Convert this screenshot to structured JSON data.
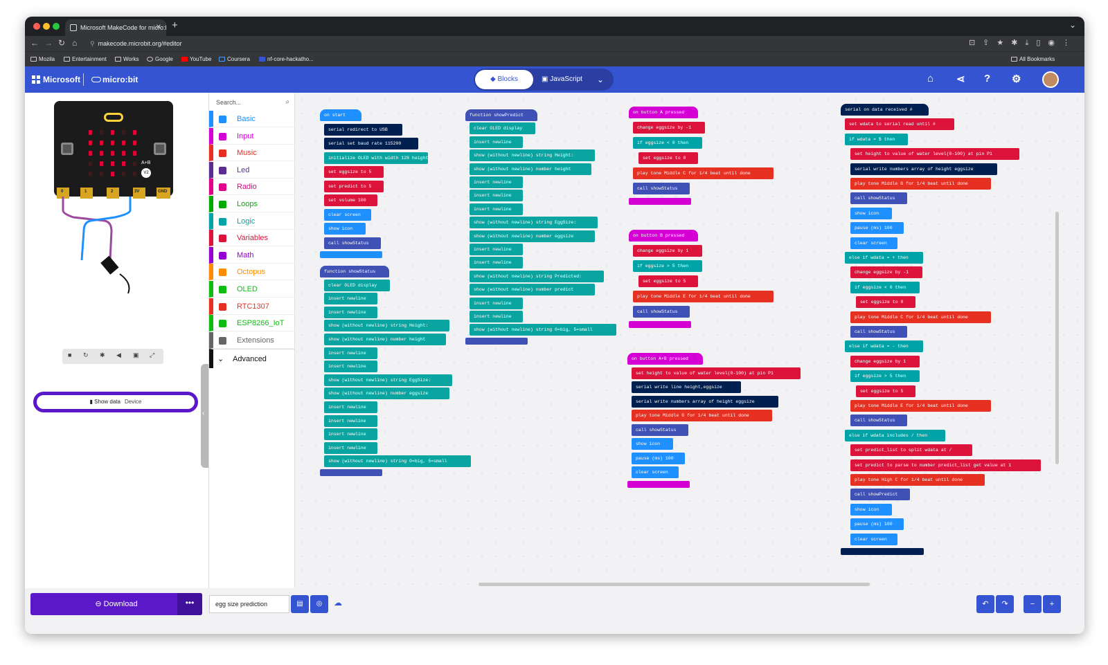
{
  "browser": {
    "tab_title": "Microsoft MakeCode for micro:bit",
    "url": "makecode.microbit.org/#editor",
    "bookmarks": [
      "Mozila",
      "Entertainment",
      "Works",
      "Google",
      "YouTube",
      "Coursera",
      "nf-core-hackatho...",
      "All Bookmarks"
    ]
  },
  "header": {
    "brand": "Microsoft",
    "product": "micro:bit",
    "tab_blocks": "Blocks",
    "tab_js": "JavaScript"
  },
  "simulator": {
    "button_label": "A+B",
    "version": "V2",
    "pins": [
      "0",
      "1",
      "2",
      "3V",
      "GND"
    ],
    "show_data": "Show data",
    "show_data_device": "Device"
  },
  "toolbox": {
    "search_placeholder": "Search...",
    "categories": [
      {
        "label": "Basic",
        "color": "#1e90ff"
      },
      {
        "label": "Input",
        "color": "#d400d4"
      },
      {
        "label": "Music",
        "color": "#e63022"
      },
      {
        "label": "Led",
        "color": "#5c2d91"
      },
      {
        "label": "Radio",
        "color": "#e3008c"
      },
      {
        "label": "Loops",
        "color": "#00aa00"
      },
      {
        "label": "Logic",
        "color": "#00a4a6"
      },
      {
        "label": "Variables",
        "color": "#dc143c"
      },
      {
        "label": "Math",
        "color": "#9400d3"
      },
      {
        "label": "Octopus",
        "color": "#ff8c00"
      },
      {
        "label": "OLED",
        "color": "#0fbc11"
      },
      {
        "label": "RTC1307",
        "color": "#e63022"
      },
      {
        "label": "ESP8266_IoT",
        "color": "#0fbc11"
      },
      {
        "label": "Extensions",
        "color": "#666666"
      }
    ],
    "advanced": "Advanced"
  },
  "blocks": {
    "on_start": [
      "on start",
      "serial redirect to USB",
      "serial set baud rate 115200",
      "initialize OLED with width 128 height 64",
      "set eggsize to 5",
      "set predict to 5",
      "set volume 100",
      "clear screen",
      "show icon",
      "call showStatus"
    ],
    "show_status": [
      "function showStatus",
      "clear OLED display",
      "insert newline",
      "insert newline",
      "show (without newline) string Height:",
      "show (without newline) number height",
      "insert newline",
      "insert newline",
      "show (without newline) string EggSize:",
      "show (without newline) number eggsize",
      "insert newline",
      "insert newline",
      "insert newline",
      "insert newline",
      "show (without newline) string 0=big, 5=small"
    ],
    "show_predict": [
      "function showPredict",
      "clear OLED display",
      "insert newline",
      "show (without newline) string Height:",
      "show (without newline) number height",
      "insert newline",
      "insert newline",
      "insert newline",
      "show (without newline) string EggSize:",
      "show (without newline) number eggsize",
      "insert newline",
      "insert newline",
      "show (without newline) string Predicted:",
      "show (without newline) number predict",
      "insert newline",
      "insert newline",
      "show (without newline) string 0=big, 5=small"
    ],
    "button_a": [
      "on button A pressed",
      "change eggsize by -1",
      "if eggsize < 0 then",
      "set eggsize to 0",
      "play tone Middle C for 1/4 beat until done",
      "call showStatus"
    ],
    "button_b": [
      "on button B pressed",
      "change eggsize by 1",
      "if eggsize > 5 then",
      "set eggsize to 5",
      "play tone Middle E for 1/4 beat until done",
      "call showStatus"
    ],
    "button_ab": [
      "on button A+B pressed",
      "set height to value of water level(0-100) at pin P1",
      "serial write line height,eggsize",
      "serial write numbers array of height eggsize",
      "play tone Middle G for 1/4 beat until done",
      "call showStatus",
      "show icon",
      "pause (ms) 100",
      "clear screen"
    ],
    "serial": [
      "serial on data received #",
      "set wdata to serial read until #",
      "if wdata = $ then",
      "set height to value of water level(0-100) at pin P1",
      "serial write numbers array of height eggsize",
      "play tone Middle G for 1/4 beat until done",
      "call showStatus",
      "show icon",
      "pause (ms) 100",
      "clear screen",
      "else if wdata = + then",
      "change eggsize by -1",
      "if eggsize < 0 then",
      "set eggsize to 0",
      "play tone Middle C for 1/4 beat until done",
      "call showStatus",
      "else if wdata = - then",
      "change eggsize by 1",
      "if eggsize > 5 then",
      "set eggsize to 5",
      "play tone Middle E for 1/4 beat until done",
      "call showStatus",
      "else if wdata includes / then",
      "set predict_list to split wdata at /",
      "set predict to parse to number predict_list get value at 1",
      "play tone High C for 1/4 beat until done",
      "call showPredict",
      "show icon",
      "pause (ms) 100",
      "clear screen"
    ]
  },
  "footer": {
    "download": "Download",
    "more": "•••",
    "project_name": "egg size prediction"
  }
}
